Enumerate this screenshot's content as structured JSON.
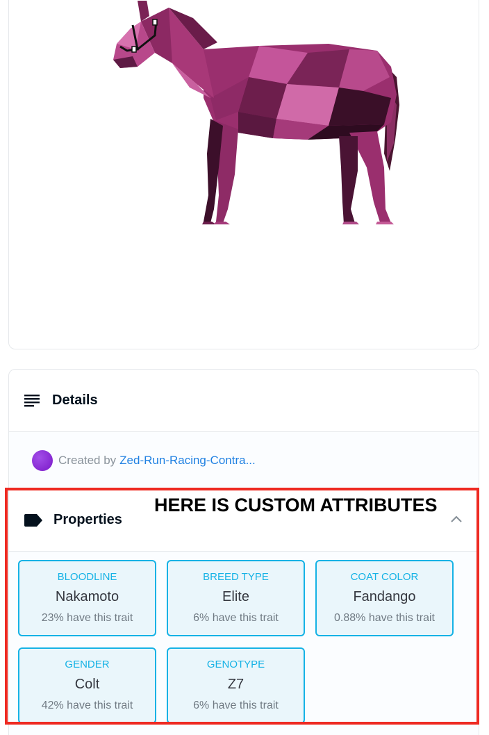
{
  "details": {
    "title": "Details",
    "created_prefix": "Created by",
    "creator_name": "Zed-Run-Racing-Contra..."
  },
  "properties": {
    "title": "Properties",
    "traits": [
      {
        "type": "BLOODLINE",
        "value": "Nakamoto",
        "rarity": "23% have this trait"
      },
      {
        "type": "BREED TYPE",
        "value": "Elite",
        "rarity": "6% have this trait"
      },
      {
        "type": "COAT COLOR",
        "value": "Fandango",
        "rarity": "0.88% have this trait"
      },
      {
        "type": "GENDER",
        "value": "Colt",
        "rarity": "42% have this trait"
      },
      {
        "type": "GENOTYPE",
        "value": "Z7",
        "rarity": "6% have this trait"
      }
    ]
  },
  "annotation": {
    "text": "HERE IS CUSTOM ATTRIBUTES"
  },
  "colors": {
    "trait_accent": "#15b2e5",
    "trait_bg": "#eaf6fb",
    "link": "#2081e2",
    "annotation": "#ee2a22",
    "horse_coat": "#b0407e",
    "avatar": "#8a2be2"
  },
  "icons": {
    "details": "lines-icon",
    "properties": "tag-icon",
    "collapse": "chevron-up-icon"
  }
}
